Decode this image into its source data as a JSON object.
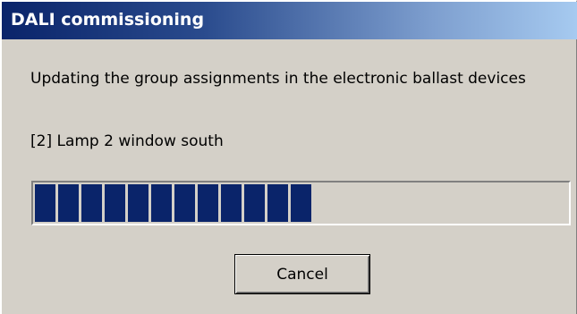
{
  "window": {
    "title": "DALI commissioning"
  },
  "body": {
    "message": "Updating the group assignments in the electronic ballast devices",
    "current_item": "[2] Lamp 2 window south"
  },
  "progress": {
    "fraction": 0.51,
    "segments_filled": 12,
    "fill_color": "#0a246a"
  },
  "buttons": {
    "cancel_label": "Cancel"
  },
  "colors": {
    "dialog_background": "#d4d0c8",
    "titlebar_start": "#0a246a",
    "titlebar_end": "#a6caf0"
  }
}
